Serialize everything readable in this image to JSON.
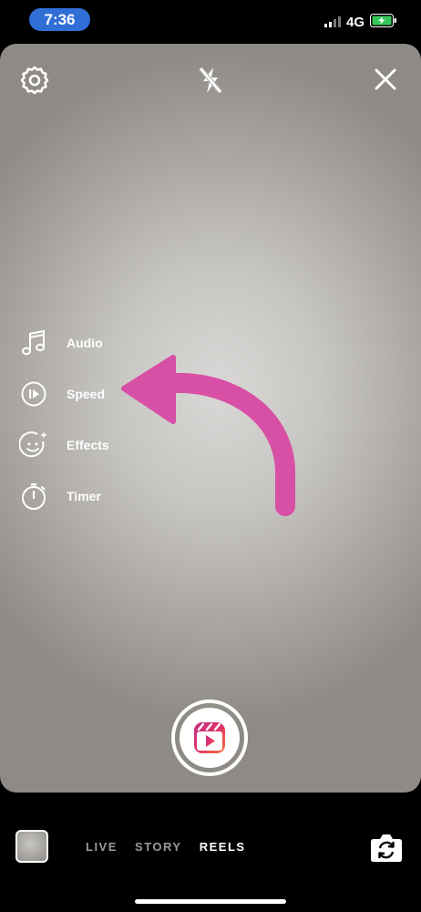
{
  "status_bar": {
    "time": "7:36",
    "network": "4G",
    "colors": {
      "time_pill": "#2f6fd6",
      "battery": "#34c759"
    }
  },
  "camera": {
    "top_controls": {
      "settings": "gear-icon",
      "flash": "flash-off-icon",
      "close": "close-icon"
    },
    "side_menu": [
      {
        "label": "Audio",
        "icon": "music-note-icon"
      },
      {
        "label": "Speed",
        "icon": "speed-icon"
      },
      {
        "label": "Effects",
        "icon": "effects-face-icon"
      },
      {
        "label": "Timer",
        "icon": "timer-icon"
      }
    ],
    "annotation_color": "#d84fa6",
    "shutter_icon": "reels-icon"
  },
  "bottom_bar": {
    "modes": [
      "LIVE",
      "STORY",
      "REELS"
    ],
    "active_mode": "REELS"
  }
}
